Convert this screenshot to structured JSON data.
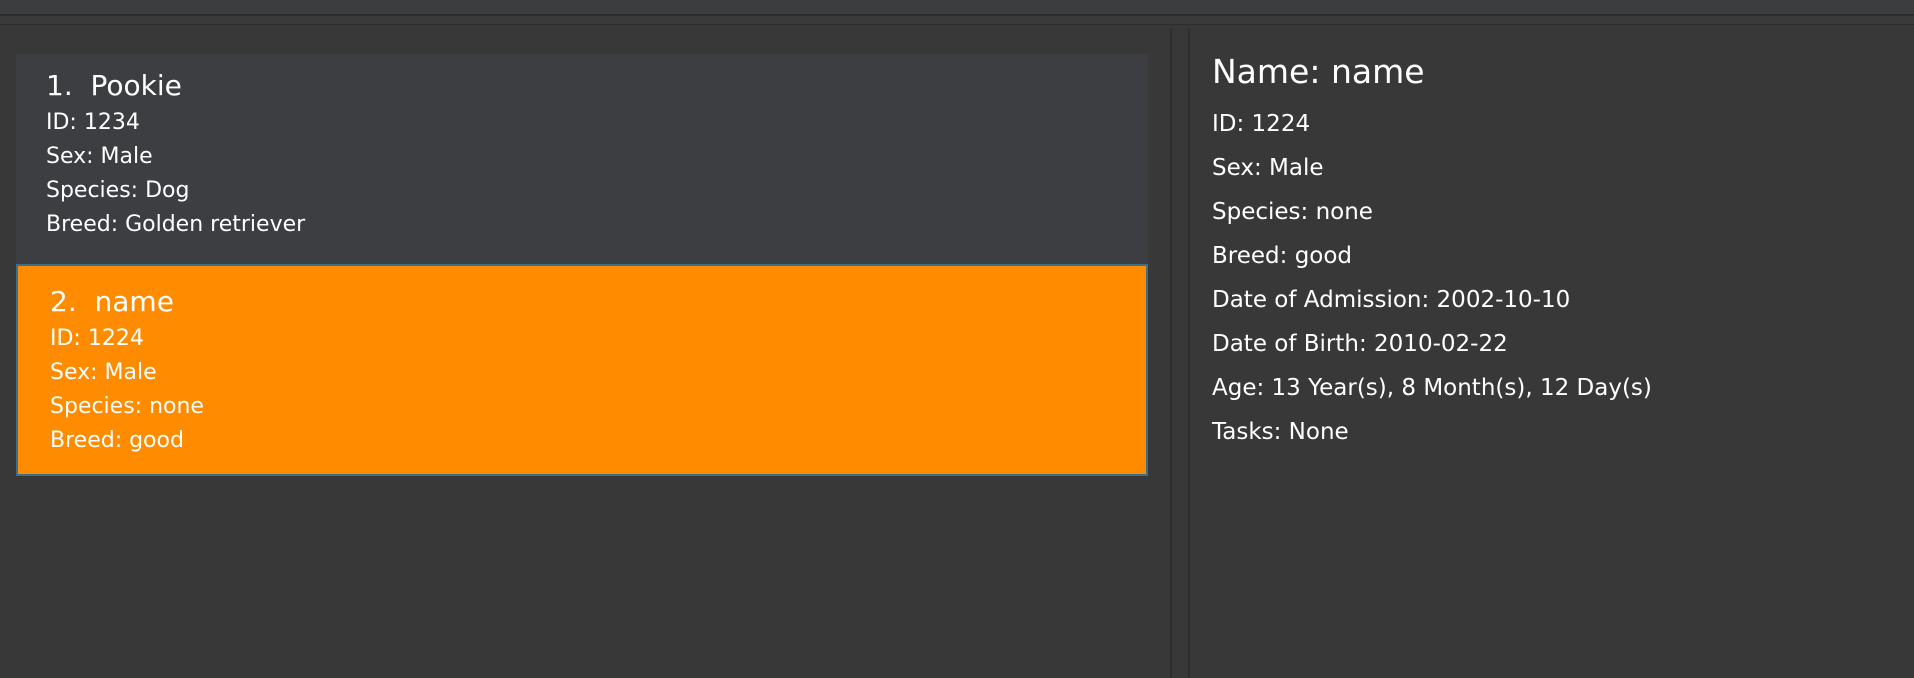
{
  "pet_list": {
    "items": [
      {
        "index_label": "1.",
        "name": "Pookie",
        "id": "ID: 1234",
        "sex": "Sex: Male",
        "species": "Species: Dog",
        "breed": "Breed: Golden retriever"
      },
      {
        "index_label": "2.",
        "name": "name",
        "id": "ID: 1224",
        "sex": "Sex: Male",
        "species": "Species: none",
        "breed": "Breed: good"
      }
    ],
    "selected_color": "#ff8c00"
  },
  "detail": {
    "title": "Name: name",
    "id": "ID: 1224",
    "sex": "Sex: Male",
    "species": "Species: none",
    "breed": "Breed: good",
    "admission": "Date of Admission: 2002-10-10",
    "birth": "Date of Birth: 2010-02-22",
    "age": "Age: 13 Year(s), 8 Month(s), 12 Day(s)",
    "tasks": "Tasks: None"
  },
  "theme": {
    "background": "#383838",
    "card_background": "#3d3e41",
    "selected_background": "#ff8c00",
    "text": "#ffffff"
  }
}
